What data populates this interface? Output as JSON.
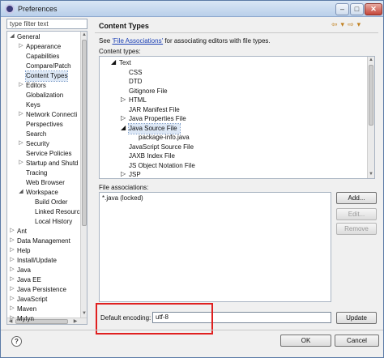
{
  "window": {
    "title": "Preferences",
    "minimize_glyph": "–",
    "maximize_glyph": "□",
    "close_glyph": "✕"
  },
  "filter": {
    "placeholder": "type filter text"
  },
  "tree": [
    {
      "label": "General",
      "toggle": "◢",
      "indent": 0
    },
    {
      "label": "Appearance",
      "toggle": "▷",
      "indent": 1
    },
    {
      "label": "Capabilities",
      "toggle": "",
      "indent": 1
    },
    {
      "label": "Compare/Patch",
      "toggle": "",
      "indent": 1
    },
    {
      "label": "Content Types",
      "toggle": "",
      "indent": 1,
      "selected": true
    },
    {
      "label": "Editors",
      "toggle": "▷",
      "indent": 1
    },
    {
      "label": "Globalization",
      "toggle": "",
      "indent": 1
    },
    {
      "label": "Keys",
      "toggle": "",
      "indent": 1
    },
    {
      "label": "Network Connecti",
      "toggle": "▷",
      "indent": 1
    },
    {
      "label": "Perspectives",
      "toggle": "",
      "indent": 1
    },
    {
      "label": "Search",
      "toggle": "",
      "indent": 1
    },
    {
      "label": "Security",
      "toggle": "▷",
      "indent": 1
    },
    {
      "label": "Service Policies",
      "toggle": "",
      "indent": 1
    },
    {
      "label": "Startup and Shutd",
      "toggle": "▷",
      "indent": 1
    },
    {
      "label": "Tracing",
      "toggle": "",
      "indent": 1
    },
    {
      "label": "Web Browser",
      "toggle": "",
      "indent": 1
    },
    {
      "label": "Workspace",
      "toggle": "◢",
      "indent": 1
    },
    {
      "label": "Build Order",
      "toggle": "",
      "indent": 2
    },
    {
      "label": "Linked Resourc",
      "toggle": "",
      "indent": 2
    },
    {
      "label": "Local History",
      "toggle": "",
      "indent": 2
    },
    {
      "label": "Ant",
      "toggle": "▷",
      "indent": 0
    },
    {
      "label": "Data Management",
      "toggle": "▷",
      "indent": 0
    },
    {
      "label": "Help",
      "toggle": "▷",
      "indent": 0
    },
    {
      "label": "Install/Update",
      "toggle": "▷",
      "indent": 0
    },
    {
      "label": "Java",
      "toggle": "▷",
      "indent": 0
    },
    {
      "label": "Java EE",
      "toggle": "▷",
      "indent": 0
    },
    {
      "label": "Java Persistence",
      "toggle": "▷",
      "indent": 0
    },
    {
      "label": "JavaScript",
      "toggle": "▷",
      "indent": 0
    },
    {
      "label": "Maven",
      "toggle": "▷",
      "indent": 0
    },
    {
      "label": "Mylyn",
      "toggle": "▷",
      "indent": 0
    }
  ],
  "page": {
    "title": "Content Types",
    "desc_prefix": "See ",
    "desc_link": "'File Associations'",
    "desc_suffix": " for associating editors with file types.",
    "content_types_label": "Content types:",
    "file_assoc_label": "File associations:",
    "encoding_label": "Default encoding:",
    "encoding_value": "utf-8"
  },
  "content_types": [
    {
      "label": "Text",
      "toggle": "◢",
      "indent": 0
    },
    {
      "label": "CSS",
      "toggle": "",
      "indent": 1
    },
    {
      "label": "DTD",
      "toggle": "",
      "indent": 1
    },
    {
      "label": "Gitignore File",
      "toggle": "",
      "indent": 1
    },
    {
      "label": "HTML",
      "toggle": "▷",
      "indent": 1
    },
    {
      "label": "JAR Manifest File",
      "toggle": "",
      "indent": 1
    },
    {
      "label": "Java Properties File",
      "toggle": "▷",
      "indent": 1
    },
    {
      "label": "Java Source File",
      "toggle": "◢",
      "indent": 1,
      "selected": true
    },
    {
      "label": "package-info.java",
      "toggle": "",
      "indent": 2
    },
    {
      "label": "JavaScript Source File",
      "toggle": "",
      "indent": 1
    },
    {
      "label": "JAXB Index File",
      "toggle": "",
      "indent": 1
    },
    {
      "label": "JS Object Notation File",
      "toggle": "",
      "indent": 1
    },
    {
      "label": "JSP",
      "toggle": "▷",
      "indent": 1
    }
  ],
  "file_associations": [
    "*.java (locked)"
  ],
  "buttons": {
    "add": "Add...",
    "edit": "Edit...",
    "remove": "Remove",
    "update": "Update",
    "ok": "OK",
    "cancel": "Cancel",
    "help": "?"
  },
  "nav": {
    "back": "⇦",
    "dropdown": "▾",
    "forward": "⇨",
    "menu": "▾"
  }
}
